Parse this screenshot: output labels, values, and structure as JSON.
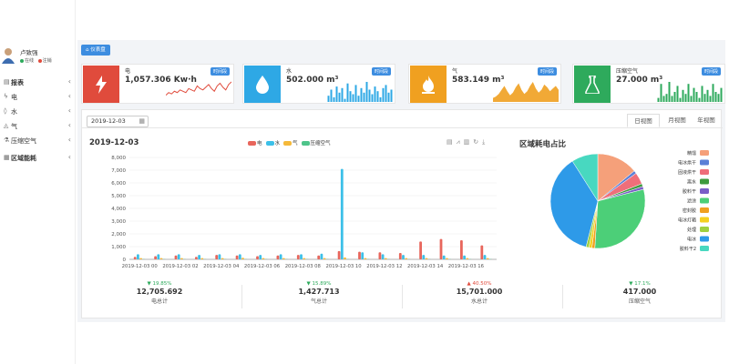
{
  "user": {
    "name": "卢致强",
    "status_online": "在线",
    "status_logout": "注销"
  },
  "sidebar": {
    "items": [
      {
        "label": "报表",
        "icon": "report-icon"
      },
      {
        "label": "电",
        "icon": "electric-icon"
      },
      {
        "label": "水",
        "icon": "water-icon"
      },
      {
        "label": "气",
        "icon": "gas-icon"
      },
      {
        "label": "压缩空气",
        "icon": "compressed-air-icon"
      },
      {
        "label": "区域能耗",
        "icon": "region-icon"
      }
    ]
  },
  "breadcrumb": "仪表盘",
  "cards": [
    {
      "name": "电",
      "value": "1,057.306 Kw·h",
      "tag": "时间段",
      "color": "#e04b3c",
      "icon": "lightning-icon",
      "spark": [
        5,
        7,
        6,
        8,
        7,
        9,
        8,
        7,
        10,
        9,
        8,
        12,
        10,
        9,
        11,
        13,
        10,
        8,
        12,
        14,
        11,
        9,
        13,
        15
      ]
    },
    {
      "name": "水",
      "value": "502.000 m³",
      "tag": "时间段",
      "color": "#2ea8e5",
      "icon": "water-drop-icon",
      "spark": [
        4,
        8,
        3,
        10,
        6,
        9,
        2,
        12,
        7,
        5,
        11,
        4,
        9,
        6,
        13,
        8,
        5,
        10,
        7,
        3,
        9,
        11,
        6,
        8
      ]
    },
    {
      "name": "气",
      "value": "583.149 m³",
      "tag": "时间段",
      "color": "#f0a020",
      "icon": "flame-icon",
      "spark": [
        3,
        4,
        6,
        9,
        12,
        8,
        5,
        7,
        11,
        14,
        9,
        6,
        8,
        12,
        15,
        10,
        7,
        9,
        13,
        11,
        8,
        10,
        12,
        9
      ]
    },
    {
      "name": "压缩空气",
      "value": "27.000 m³",
      "tag": "时间段",
      "color": "#2eaa5c",
      "icon": "flask-icon",
      "spark": [
        2,
        9,
        3,
        4,
        10,
        3,
        5,
        8,
        2,
        6,
        4,
        9,
        3,
        7,
        5,
        2,
        8,
        4,
        6,
        3,
        9,
        5,
        4,
        7
      ]
    }
  ],
  "date": "2019-12-03",
  "tabs": {
    "day": "日视图",
    "month": "月视图",
    "year": "年视图"
  },
  "chart_title": "2019-12-03",
  "pie_title": "区域耗电占比",
  "stats": [
    {
      "pct": "▼ 19.85%",
      "pct_color": "#2eaa5c",
      "value": "12,705.692",
      "label": "电总计"
    },
    {
      "pct": "▼ 15.89%",
      "pct_color": "#2eaa5c",
      "value": "1,427.713",
      "label": "气总计"
    },
    {
      "pct": "▲ 40.50%",
      "pct_color": "#e04b3c",
      "value": "15,701.000",
      "label": "水总计"
    },
    {
      "pct": "▼ 17.1%",
      "pct_color": "#2eaa5c",
      "value": "417.000",
      "label": "压缩空气"
    }
  ],
  "chart_data": [
    {
      "type": "bar",
      "title": "2019-12-03",
      "categories": [
        "00",
        "01",
        "02",
        "03",
        "04",
        "05",
        "06",
        "07",
        "08",
        "09",
        "10",
        "11",
        "12",
        "13",
        "14",
        "15",
        "16",
        "17"
      ],
      "tick_labels": [
        "2019-12-03 00",
        "2019-12-03 02",
        "2019-12-03 04",
        "2019-12-03 06",
        "2019-12-03 08",
        "2019-12-03 10",
        "2019-12-03 12",
        "2019-12-03 14",
        "2019-12-03 16"
      ],
      "ylim": [
        0,
        8000
      ],
      "yticks": [
        "0",
        "1,000",
        "2,000",
        "3,000",
        "4,000",
        "5,000",
        "6,000",
        "7,000",
        "8,000"
      ],
      "series": [
        {
          "name": "电",
          "color": "#e8665c",
          "values": [
            200,
            250,
            300,
            200,
            350,
            300,
            250,
            300,
            350,
            300,
            650,
            600,
            550,
            500,
            1400,
            1600,
            1500,
            1100
          ]
        },
        {
          "name": "水",
          "color": "#3cc0e8",
          "values": [
            400,
            400,
            400,
            350,
            400,
            400,
            350,
            400,
            400,
            450,
            7100,
            550,
            400,
            350,
            350,
            300,
            300,
            350
          ]
        },
        {
          "name": "气",
          "color": "#f5b93a",
          "values": [
            100,
            100,
            100,
            100,
            100,
            120,
            100,
            100,
            100,
            100,
            150,
            100,
            100,
            100,
            100,
            100,
            100,
            100
          ]
        },
        {
          "name": "压缩空气",
          "color": "#4ec48a",
          "values": [
            20,
            20,
            20,
            20,
            20,
            20,
            20,
            20,
            20,
            20,
            20,
            20,
            20,
            20,
            20,
            20,
            20,
            20
          ]
        }
      ]
    },
    {
      "type": "pie",
      "title": "区域耗电占比",
      "slices": [
        {
          "label": "精馏",
          "value": 14,
          "color": "#f5a07a"
        },
        {
          "label": "电冰烘干",
          "value": 1,
          "color": "#5b7fd6"
        },
        {
          "label": "固液烘干",
          "value": 4,
          "color": "#ef6e7a"
        },
        {
          "label": "离水",
          "value": 1,
          "color": "#3e9a3e"
        },
        {
          "label": "胶料干",
          "value": 1,
          "color": "#7a5ec8"
        },
        {
          "label": "滤涂",
          "value": 30,
          "color": "#4ccf78"
        },
        {
          "label": "密封胶",
          "value": 1,
          "color": "#f0a020"
        },
        {
          "label": "电冰灯箱",
          "value": 1,
          "color": "#f5d020"
        },
        {
          "label": "处理",
          "value": 1,
          "color": "#a0d040"
        },
        {
          "label": "电冰",
          "value": 37,
          "color": "#2e9ae8"
        },
        {
          "label": "胶料干2",
          "value": 9,
          "color": "#48d8c0"
        }
      ]
    }
  ]
}
